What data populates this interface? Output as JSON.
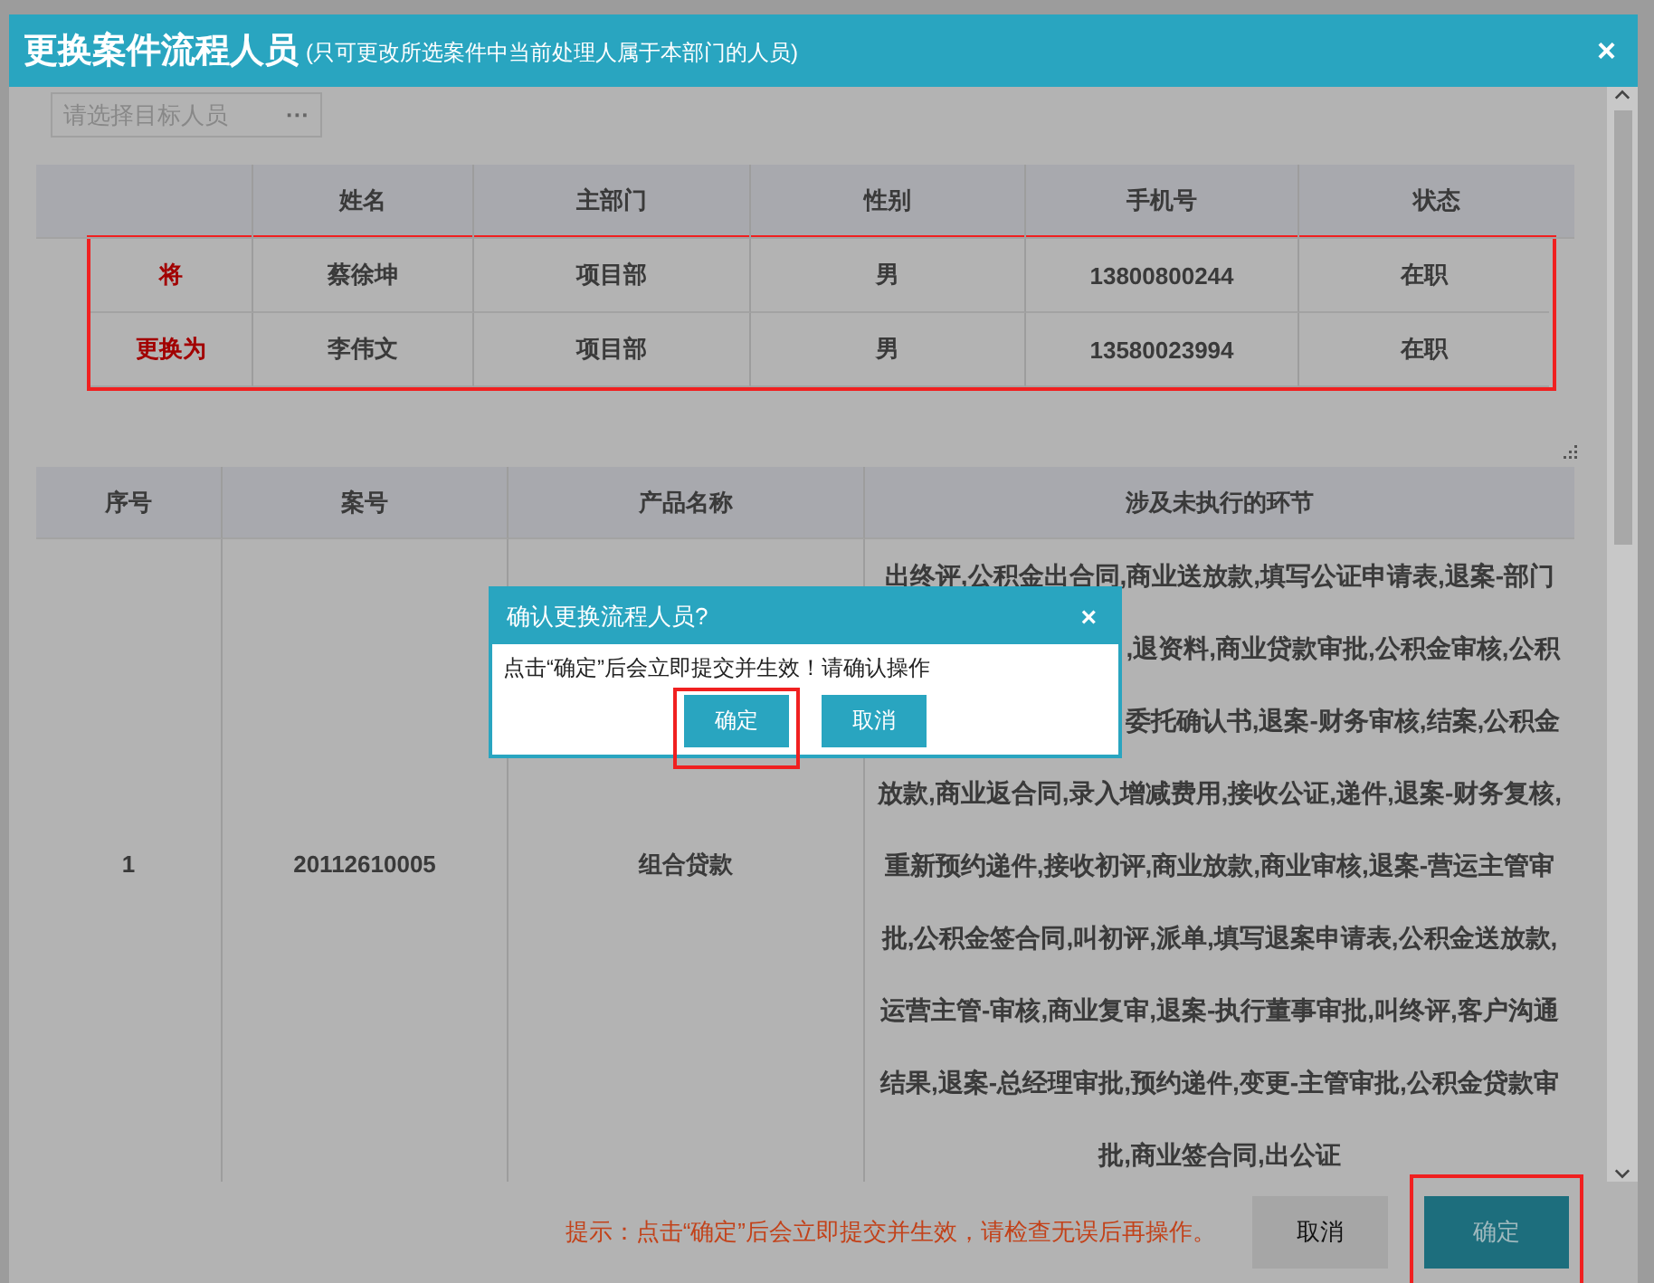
{
  "dialog": {
    "title": "更换案件流程人员",
    "subtitle": "(只可更改所选案件中当前处理人属于本部门的人员)",
    "close": "×"
  },
  "target_select": {
    "placeholder": "请选择目标人员",
    "more": "···"
  },
  "person_table": {
    "highlighted": true,
    "columns": [
      "姓名",
      "主部门",
      "性别",
      "手机号",
      "状态"
    ],
    "rows": [
      {
        "label": "将",
        "cells": [
          "蔡徐坤",
          "项目部",
          "男",
          "13800800244",
          "在职"
        ]
      },
      {
        "label": "更换为",
        "cells": [
          "李伟文",
          "项目部",
          "男",
          "13580023994",
          "在职"
        ]
      }
    ]
  },
  "case_table": {
    "columns": [
      "序号",
      "案号",
      "产品名称",
      "涉及未执行的环节"
    ],
    "rows": [
      {
        "index": "1",
        "case_no": "20112610005",
        "product": "组合贷款",
        "steps": [
          {
            "text": "出终评,公积金出合同,商业送放款,填写公证申请表,退案-部门",
            "kind": "full"
          },
          {
            "text": ",退资料,商业贷款审批,公积金审核,公积",
            "kind": "partial"
          },
          {
            "text": "委托确认书,退案-财务审核,结案,公积金",
            "kind": "partial"
          },
          {
            "text": "放款,商业返合同,录入增减费用,接收公证,递件,退案-财务复核,",
            "kind": "full"
          },
          {
            "text": "重新预约递件,接收初评,商业放款,商业审核,退案-营运主管审",
            "kind": "full"
          },
          {
            "text": "批,公积金签合同,叫初评,派单,填写退案申请表,公积金送放款,",
            "kind": "full"
          },
          {
            "text": "运营主管-审核,商业复审,退案-执行董事审批,叫终评,客户沟通",
            "kind": "full"
          },
          {
            "text": "结果,退案-总经理审批,预约递件,变更-主管审批,公积金贷款审",
            "kind": "full"
          },
          {
            "text": "批,商业签合同,出公证",
            "kind": "full"
          }
        ]
      }
    ]
  },
  "footer": {
    "hint": "提示：点击“确定”后会立即提交并生效，请检查无误后再操作。",
    "buttons": [
      {
        "label": "取消",
        "kind": "secondary",
        "highlighted": false
      },
      {
        "label": "确定",
        "kind": "primary",
        "highlighted": true
      }
    ]
  },
  "confirm_popup": {
    "title": "确认更换流程人员?",
    "close": "×",
    "message": "点击“确定”后会立即提交并生效！请确认操作",
    "buttons": [
      {
        "label": "确定",
        "highlighted": true
      },
      {
        "label": "取消",
        "highlighted": false
      }
    ]
  }
}
